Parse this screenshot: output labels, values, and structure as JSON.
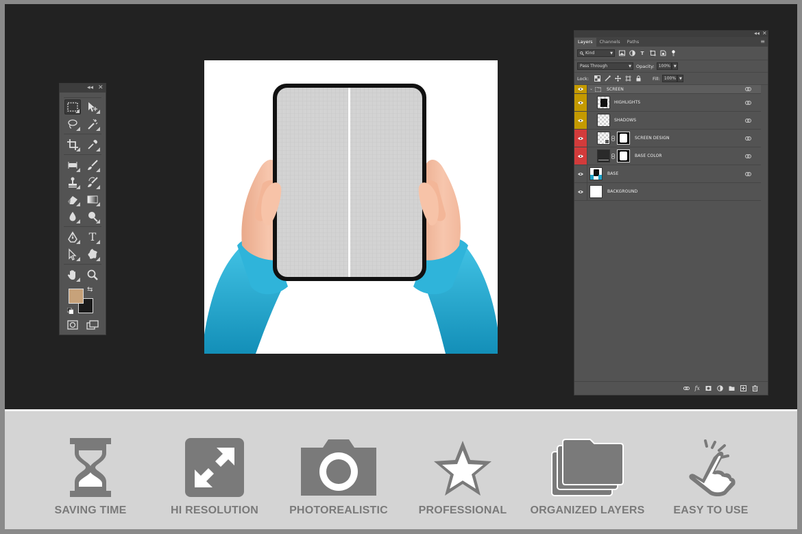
{
  "colors": {
    "frame": "#8a8a8a",
    "workspace": "#222222",
    "panel": "#535353",
    "feature_band": "#d4d4d4",
    "feature_gray": "#7a7a7a",
    "foreground_swatch": "#c7a27a",
    "background_swatch": "#1b1b1b",
    "eye_yellow": "#c49a00",
    "eye_red": "#d23b3b",
    "sleeve_blue": "#1fa3c9"
  },
  "toolbox": {
    "collapse_glyph": "◂◂",
    "close_glyph": "✕",
    "tools": [
      [
        "marquee-tool-icon",
        "move-tool-icon"
      ],
      [
        "lasso-tool-icon",
        "magic-wand-tool-icon"
      ],
      [
        "crop-tool-icon",
        "eyedropper-tool-icon"
      ],
      [
        "healing-brush-tool-icon",
        "brush-tool-icon"
      ],
      [
        "clone-stamp-tool-icon",
        "history-brush-tool-icon"
      ],
      [
        "eraser-tool-icon",
        "gradient-tool-icon"
      ],
      [
        "blur-tool-icon",
        "dodge-tool-icon"
      ],
      [
        "pen-tool-icon",
        "type-tool-icon"
      ],
      [
        "path-selection-tool-icon",
        "custom-shape-tool-icon"
      ],
      [
        "hand-tool-icon",
        "zoom-tool-icon"
      ]
    ],
    "type_tool_glyph": "T",
    "swap_glyph": "⇆"
  },
  "layers_panel": {
    "collapse_glyph": "◂◂",
    "close_glyph": "✕",
    "tabs": [
      {
        "label": "Layers",
        "active": true
      },
      {
        "label": "Channels",
        "active": false
      },
      {
        "label": "Paths",
        "active": false
      }
    ],
    "menu_glyph": "≡",
    "filter": {
      "label": "Kind"
    },
    "blend_mode": "Pass Through",
    "opacity_label": "Opacity:",
    "opacity_value": "100%",
    "lock_label": "Lock:",
    "fill_label": "Fill:",
    "fill_value": "100%",
    "filter_glyphs": {
      "type": "T"
    },
    "layers": [
      {
        "name": "SCREEN",
        "type": "group",
        "eye_color": "yellow"
      },
      {
        "name": "HIGHLIGHTS",
        "type": "layer",
        "eye_color": "yellow",
        "indent": true
      },
      {
        "name": "SHADOWS",
        "type": "layer",
        "eye_color": "yellow",
        "indent": true
      },
      {
        "name": "SCREEN DESIGN",
        "type": "smart-mask",
        "eye_color": "red",
        "indent": true
      },
      {
        "name": "BASE COLOR",
        "type": "layer-mask",
        "eye_color": "red",
        "indent": true
      },
      {
        "name": "BASE",
        "type": "layer",
        "eye_color": "none",
        "indent": false
      },
      {
        "name": "BACKGROUND",
        "type": "layer",
        "eye_color": "none",
        "indent": false
      }
    ],
    "bottom_glyphs": {
      "fx": "fx"
    }
  },
  "features": [
    {
      "label": "SAVING TIME",
      "icon": "hourglass-icon"
    },
    {
      "label": "HI RESOLUTION",
      "icon": "expand-arrows-icon"
    },
    {
      "label": "PHOTOREALISTIC",
      "icon": "camera-icon"
    },
    {
      "label": "PROFESSIONAL",
      "icon": "star-icon"
    },
    {
      "label": "ORGANIZED LAYERS",
      "icon": "stacked-folders-icon"
    },
    {
      "label": "EASY TO USE",
      "icon": "tap-hand-icon"
    }
  ]
}
